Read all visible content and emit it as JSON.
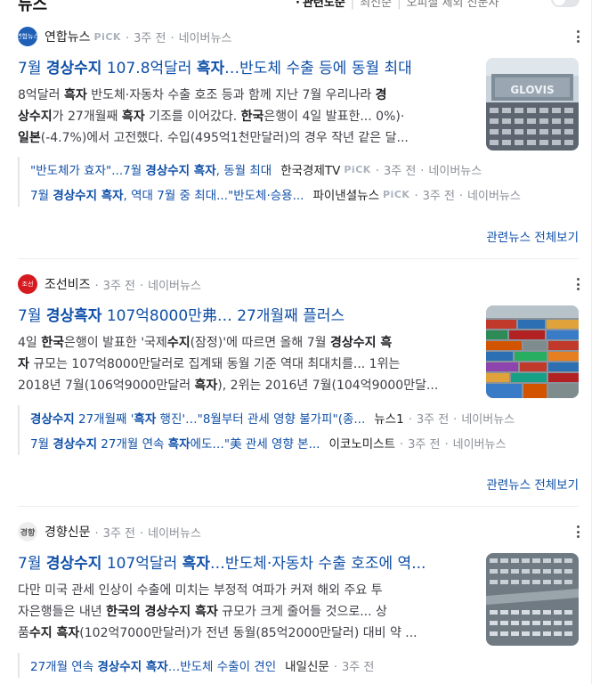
{
  "top": {
    "section_title": "뉴스",
    "sort_current": "관련도순",
    "sort_other": "최신순",
    "filter_label": "오피셜 제외 신문사"
  },
  "articles": [
    {
      "press": "연합뉴스",
      "logo_text": "연합뉴스",
      "pick": "PiCK",
      "time": "3주 전",
      "source": "네이버뉴스",
      "title": [
        "7월 ",
        "경상수지",
        " 107.8억달러 ",
        "흑자",
        "…반도체 수출 등에 동월 최대"
      ],
      "desc_line1": [
        "8억달러 ",
        "흑자",
        " 반도체·자동차 수출 호조 등과 함께 지난 7월 우리나라 ",
        "경"
      ],
      "desc_line2": [
        "상수지",
        "가 27개월째 ",
        "흑자",
        " 기조를 이어갔다. ",
        "한국",
        "은행이 4일 발표한... 0%)·"
      ],
      "desc_line3": [
        "일본",
        "(-4.7%)에서 고전했다. 수입(495억1천만달러)의 경우 작년 같은 달..."
      ],
      "thumb": "cars-port",
      "related": [
        {
          "link": [
            "\"반도체가 효자\"...7월 ",
            "경상수지 흑자",
            ", 동월 최대"
          ],
          "press": "한국경제TV",
          "pick": "PiCK",
          "time": "3주 전",
          "source": "네이버뉴스"
        },
        {
          "link": [
            "7월 ",
            "경상수지 흑자",
            ", 역대 7월 중 최대...\"반도체·승용..."
          ],
          "press": "파이낸셜뉴스",
          "pick": "PiCK",
          "time": "3주 전",
          "source": "네이버뉴스"
        }
      ],
      "more": "관련뉴스 전체보기"
    },
    {
      "press": "조선비즈",
      "logo_text": "조선",
      "time": "3주 전",
      "source": "네이버뉴스",
      "title": [
        "7월 ",
        "경상흑자",
        " 107억8000만弗… 27개월째 플러스"
      ],
      "desc_line1": [
        "4일 ",
        "한국",
        "은행이 발표한 '국제",
        "수지",
        "(잠정)'에 따르면 올해 7월 ",
        "경상수지 흑"
      ],
      "desc_line2": [
        "자",
        " 규모는 107억8000만달러로 집계돼 동월 기준 역대 최대치를... 1위는"
      ],
      "desc_line3": [
        "2018년 7월(106억9000만달러 ",
        "흑자",
        "), 2위는 2016년 7월(104억9000만달..."
      ],
      "thumb": "containers",
      "related": [
        {
          "link": [
            "경상수지",
            " 27개월째 '",
            "흑자",
            " 행진'…\"8월부터 관세 영향 불가피\"(종..."
          ],
          "press": "뉴스1",
          "time": "3주 전",
          "source": "네이버뉴스"
        },
        {
          "link": [
            "7월 ",
            "경상수지",
            " 27개월 연속 ",
            "흑자",
            "에도…\"美 관세 영향 본..."
          ],
          "press": "이코노미스트",
          "time": "3주 전",
          "source": "네이버뉴스"
        }
      ],
      "more": "관련뉴스 전체보기"
    },
    {
      "press": "경향신문",
      "logo_text": "경향",
      "time": "3주 전",
      "source": "네이버뉴스",
      "title": [
        "7월 ",
        "경상수지",
        " 107억달러 ",
        "흑자",
        "…반도체·자동차 수출 호조에 역..."
      ],
      "desc_line1": [
        "다만 미국 관세 인상이 수출에 미치는 부정적 여파가 커져 해외 주요 투"
      ],
      "desc_line2": [
        "자은행들은 내년 ",
        "한국의 경상수지 흑자",
        " 규모가 크게 줄어들 것으로... 상"
      ],
      "desc_line3": [
        "품",
        "수지 흑자",
        "(102억7000만달러)가 전년 동월(85억2000만달러) 대비 약 ..."
      ],
      "thumb": "cars-lot",
      "related": [
        {
          "link": [
            "27개월 연속 ",
            "경상수지 흑자",
            "…반도체 수출이 견인"
          ],
          "press": "내일신문",
          "time": "3주 전"
        }
      ]
    }
  ],
  "colors": {
    "link": "#0f4fa8",
    "meta": "#8b8f97",
    "pick": "#aab2bd"
  }
}
